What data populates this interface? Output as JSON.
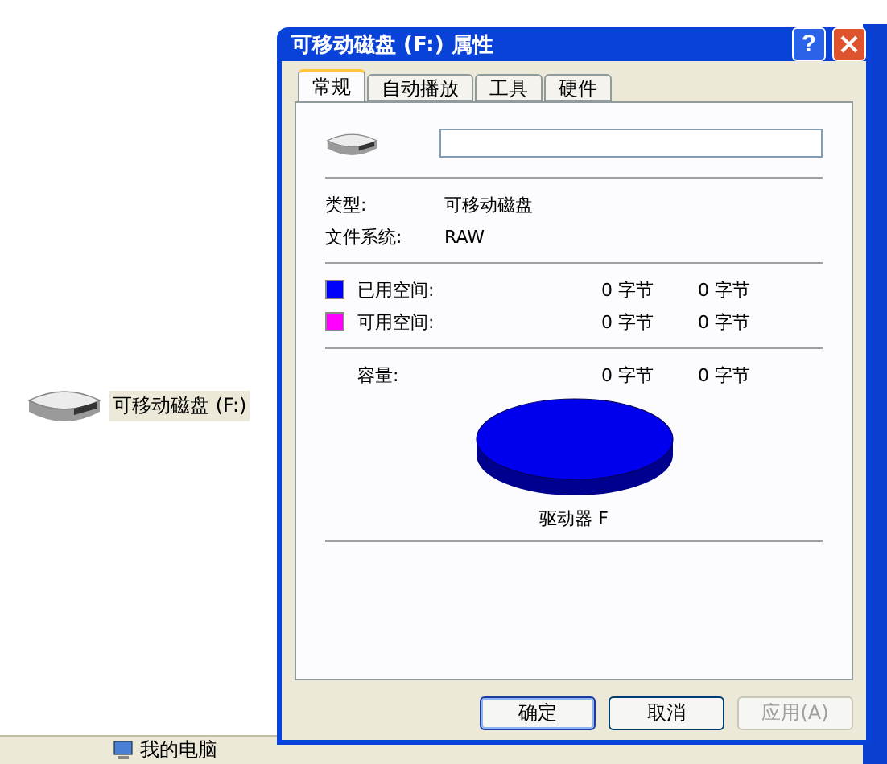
{
  "background": {
    "drive_label": "可移动磁盘 (F:)",
    "status_item": "我的电脑"
  },
  "dialog": {
    "title": "可移动磁盘 (F:) 属性",
    "help": "?",
    "tabs": [
      {
        "label": "常规",
        "selected": true
      },
      {
        "label": "自动播放",
        "selected": false
      },
      {
        "label": "工具",
        "selected": false
      },
      {
        "label": "硬件",
        "selected": false
      }
    ],
    "type_label": "类型:",
    "type_value": "可移动磁盘",
    "fs_label": "文件系统:",
    "fs_value": "RAW",
    "space": [
      {
        "label": "已用空间:",
        "color": "#0000ff",
        "bytes": "0 字节",
        "size": "0 字节"
      },
      {
        "label": "可用空间:",
        "color": "#ff00ff",
        "bytes": "0 字节",
        "size": "0 字节"
      }
    ],
    "capacity": {
      "label": "容量:",
      "bytes": "0 字节",
      "size": "0 字节"
    },
    "chart_caption": "驱动器 F",
    "buttons": [
      {
        "label": "确定",
        "kind": "default",
        "disabled": false
      },
      {
        "label": "取消",
        "kind": "normal",
        "disabled": false
      },
      {
        "label": "应用(A)",
        "kind": "normal",
        "disabled": true
      }
    ]
  }
}
